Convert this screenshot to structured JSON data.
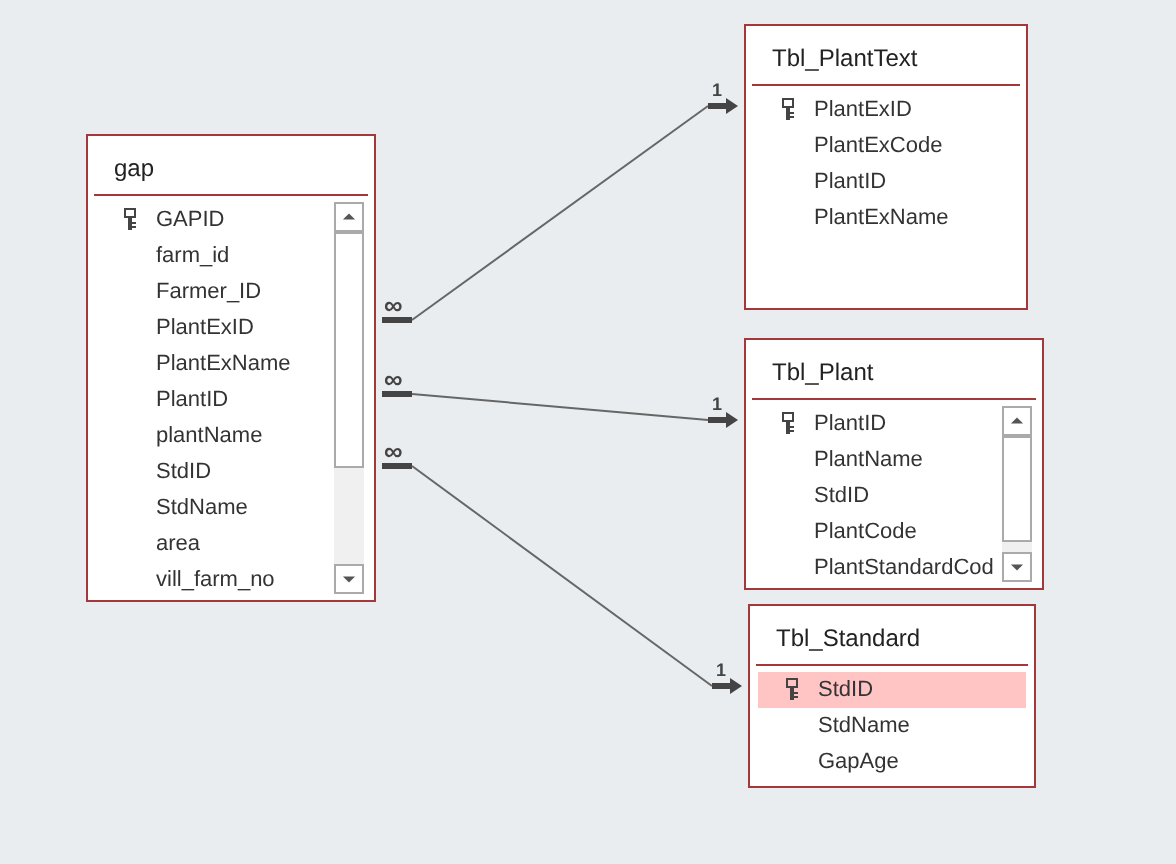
{
  "tables": [
    {
      "title": "gap",
      "scrollbar": true,
      "fields": [
        {
          "name": "GAPID",
          "primary_key": true,
          "selected": false
        },
        {
          "name": "farm_id",
          "primary_key": false,
          "selected": false
        },
        {
          "name": "Farmer_ID",
          "primary_key": false,
          "selected": false
        },
        {
          "name": "PlantExID",
          "primary_key": false,
          "selected": false
        },
        {
          "name": "PlantExName",
          "primary_key": false,
          "selected": false
        },
        {
          "name": "PlantID",
          "primary_key": false,
          "selected": false
        },
        {
          "name": "plantName",
          "primary_key": false,
          "selected": false
        },
        {
          "name": "StdID",
          "primary_key": false,
          "selected": false
        },
        {
          "name": "StdName",
          "primary_key": false,
          "selected": false
        },
        {
          "name": "area",
          "primary_key": false,
          "selected": false
        },
        {
          "name": "vill_farm_no",
          "primary_key": false,
          "selected": false
        }
      ]
    },
    {
      "title": "Tbl_PlantText",
      "scrollbar": false,
      "fields": [
        {
          "name": "PlantExID",
          "primary_key": true,
          "selected": false
        },
        {
          "name": "PlantExCode",
          "primary_key": false,
          "selected": false
        },
        {
          "name": "PlantID",
          "primary_key": false,
          "selected": false
        },
        {
          "name": "PlantExName",
          "primary_key": false,
          "selected": false
        }
      ]
    },
    {
      "title": "Tbl_Plant",
      "scrollbar": true,
      "fields": [
        {
          "name": "PlantID",
          "primary_key": true,
          "selected": false
        },
        {
          "name": "PlantName",
          "primary_key": false,
          "selected": false
        },
        {
          "name": "StdID",
          "primary_key": false,
          "selected": false
        },
        {
          "name": "PlantCode",
          "primary_key": false,
          "selected": false
        },
        {
          "name": "PlantStandardCod",
          "primary_key": false,
          "selected": false
        }
      ]
    },
    {
      "title": "Tbl_Standard",
      "scrollbar": false,
      "fields": [
        {
          "name": "StdID",
          "primary_key": true,
          "selected": true
        },
        {
          "name": "StdName",
          "primary_key": false,
          "selected": false
        },
        {
          "name": "GapAge",
          "primary_key": false,
          "selected": false
        }
      ]
    }
  ],
  "relationships": [
    {
      "many_label": "∞",
      "one_label": "1"
    },
    {
      "many_label": "∞",
      "one_label": "1"
    },
    {
      "many_label": "∞",
      "one_label": "1"
    }
  ]
}
